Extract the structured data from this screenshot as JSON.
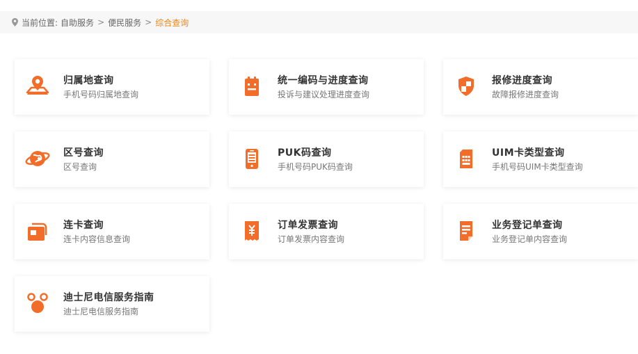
{
  "breadcrumb": {
    "prefix": "当前位置:",
    "items": [
      "自助服务",
      "便民服务"
    ],
    "current": "综合查询",
    "separator": ">"
  },
  "accent_color": "#f26d2a",
  "cards": [
    {
      "title": "归属地查询",
      "desc": "手机号码归属地查询",
      "icon": "map-pin-icon"
    },
    {
      "title": "统一编码与进度查询",
      "desc": "投诉与建议处理进度查询",
      "icon": "clipboard-icon"
    },
    {
      "title": "报修进度查询",
      "desc": "故障报修进度查询",
      "icon": "shield-icon"
    },
    {
      "title": "区号查询",
      "desc": "区号查询",
      "icon": "globe-icon"
    },
    {
      "title": "PUK码查询",
      "desc": "手机号码PUK码查询",
      "icon": "phone-icon"
    },
    {
      "title": "UIM卡类型查询",
      "desc": "手机号码UIM卡类型查询",
      "icon": "sim-card-icon"
    },
    {
      "title": "连卡查询",
      "desc": "连卡内容信息查询",
      "icon": "cards-icon"
    },
    {
      "title": "订单发票查询",
      "desc": "订单发票内容查询",
      "icon": "invoice-icon"
    },
    {
      "title": "业务登记单查询",
      "desc": "业务登记单内容查询",
      "icon": "document-icon"
    },
    {
      "title": "迪士尼电信服务指南",
      "desc": "迪士尼电信服务指南",
      "icon": "mickey-icon"
    }
  ]
}
